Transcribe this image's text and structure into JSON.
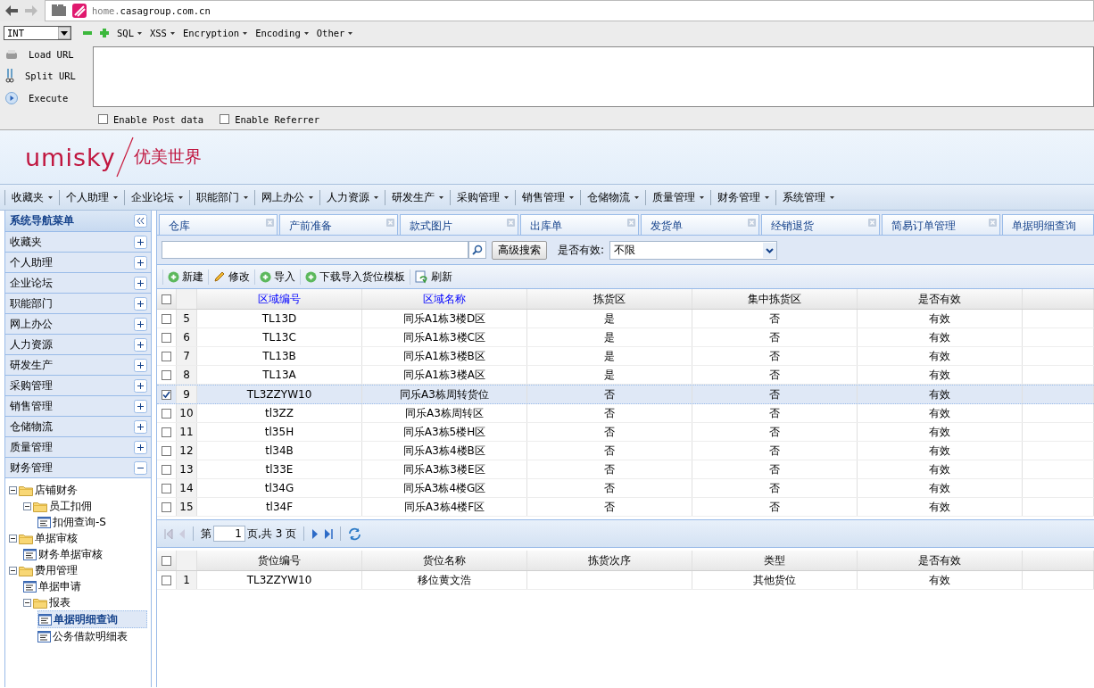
{
  "browser": {
    "url_host": "home.",
    "url_domain": "casagroup.com.cn"
  },
  "hackbar": {
    "type_select": "INT",
    "menus": [
      "SQL",
      "XSS",
      "Encryption",
      "Encoding",
      "Other"
    ],
    "actions": [
      {
        "label": "Load URL",
        "kind": "load"
      },
      {
        "label": "Split URL",
        "kind": "split"
      },
      {
        "label": "Execute",
        "kind": "execute"
      }
    ],
    "options": [
      {
        "label": "Enable Post data",
        "checked": false
      },
      {
        "label": "Enable Referrer",
        "checked": false
      }
    ]
  },
  "header": {
    "logo_latin": "umisky",
    "logo_cn": "优美世界"
  },
  "menu": [
    "收藏夹",
    "个人助理",
    "企业论坛",
    "职能部门",
    "网上办公",
    "人力资源",
    "研发生产",
    "采购管理",
    "销售管理",
    "仓储物流",
    "质量管理",
    "财务管理",
    "系统管理"
  ],
  "sidebar": {
    "title": "系统导航菜单",
    "items": [
      {
        "label": "收藏夹",
        "expanded": false
      },
      {
        "label": "个人助理",
        "expanded": false
      },
      {
        "label": "企业论坛",
        "expanded": false
      },
      {
        "label": "职能部门",
        "expanded": false
      },
      {
        "label": "网上办公",
        "expanded": false
      },
      {
        "label": "人力资源",
        "expanded": false
      },
      {
        "label": "研发生产",
        "expanded": false
      },
      {
        "label": "采购管理",
        "expanded": false
      },
      {
        "label": "销售管理",
        "expanded": false
      },
      {
        "label": "仓储物流",
        "expanded": false
      },
      {
        "label": "质量管理",
        "expanded": false
      },
      {
        "label": "财务管理",
        "expanded": true
      }
    ],
    "tree": [
      {
        "label": "店铺财务",
        "kind": "folder",
        "selected": false,
        "children": [
          {
            "label": "员工扣佣",
            "kind": "folder",
            "selected": false,
            "children": [
              {
                "label": "扣佣查询-S",
                "kind": "page",
                "selected": false
              }
            ]
          }
        ]
      },
      {
        "label": "单据审核",
        "kind": "folder",
        "selected": false,
        "children": [
          {
            "label": "财务单据审核",
            "kind": "page",
            "selected": false
          }
        ]
      },
      {
        "label": "费用管理",
        "kind": "folder",
        "selected": false,
        "children": [
          {
            "label": "单据申请",
            "kind": "page",
            "selected": false
          },
          {
            "label": "报表",
            "kind": "folder",
            "selected": false,
            "children": [
              {
                "label": "单据明细查询",
                "kind": "page",
                "selected": true
              },
              {
                "label": "公务借款明细表",
                "kind": "page",
                "selected": false
              }
            ]
          }
        ]
      }
    ]
  },
  "tabs": [
    {
      "label": "仓库",
      "closable": true
    },
    {
      "label": "产前准备",
      "closable": true
    },
    {
      "label": "款式图片",
      "closable": true
    },
    {
      "label": "出库单",
      "closable": true
    },
    {
      "label": "发货单",
      "closable": true
    },
    {
      "label": "经销退货",
      "closable": true
    },
    {
      "label": "简易订单管理",
      "closable": true
    },
    {
      "label": "单据明细查询",
      "closable": false
    }
  ],
  "search": {
    "button": "高级搜索",
    "filter_label": "是否有效:",
    "filter_value": "不限"
  },
  "toolbar": [
    {
      "label": "新建",
      "kind": "add"
    },
    {
      "label": "修改",
      "kind": "edit"
    },
    {
      "label": "导入",
      "kind": "add"
    },
    {
      "label": "下载导入货位模板",
      "kind": "add"
    },
    {
      "label": "刷新",
      "kind": "refresh"
    }
  ],
  "grid": {
    "all_selected": false,
    "columns": [
      {
        "label": "区域编号",
        "link": true
      },
      {
        "label": "区域名称",
        "link": true
      },
      {
        "label": "拣货区",
        "link": false
      },
      {
        "label": "集中拣货区",
        "link": false
      },
      {
        "label": "是否有效",
        "link": false
      }
    ],
    "rows": [
      {
        "num": "5",
        "code": "TL13D",
        "name": "同乐A1栋3楼D区",
        "pick": "是",
        "central": "否",
        "valid": "有效",
        "selected": false
      },
      {
        "num": "6",
        "code": "TL13C",
        "name": "同乐A1栋3楼C区",
        "pick": "是",
        "central": "否",
        "valid": "有效",
        "selected": false
      },
      {
        "num": "7",
        "code": "TL13B",
        "name": "同乐A1栋3楼B区",
        "pick": "是",
        "central": "否",
        "valid": "有效",
        "selected": false
      },
      {
        "num": "8",
        "code": "TL13A",
        "name": "同乐A1栋3楼A区",
        "pick": "是",
        "central": "否",
        "valid": "有效",
        "selected": false
      },
      {
        "num": "9",
        "code": "TL3ZZYW10",
        "name": "同乐A3栋周转货位",
        "pick": "否",
        "central": "否",
        "valid": "有效",
        "selected": true
      },
      {
        "num": "10",
        "code": "tl3ZZ",
        "name": "同乐A3栋周转区",
        "pick": "否",
        "central": "否",
        "valid": "有效",
        "selected": false
      },
      {
        "num": "11",
        "code": "tl35H",
        "name": "同乐A3栋5楼H区",
        "pick": "否",
        "central": "否",
        "valid": "有效",
        "selected": false
      },
      {
        "num": "12",
        "code": "tl34B",
        "name": "同乐A3栋4楼B区",
        "pick": "否",
        "central": "否",
        "valid": "有效",
        "selected": false
      },
      {
        "num": "13",
        "code": "tl33E",
        "name": "同乐A3栋3楼E区",
        "pick": "否",
        "central": "否",
        "valid": "有效",
        "selected": false
      },
      {
        "num": "14",
        "code": "tl34G",
        "name": "同乐A3栋4楼G区",
        "pick": "否",
        "central": "否",
        "valid": "有效",
        "selected": false
      },
      {
        "num": "15",
        "code": "tl34F",
        "name": "同乐A3栋4楼F区",
        "pick": "否",
        "central": "否",
        "valid": "有效",
        "selected": false
      }
    ]
  },
  "pager": {
    "before": "第",
    "page": "1",
    "after": "页,共 3 页"
  },
  "detail": {
    "all_selected": false,
    "columns": [
      "货位编号",
      "货位名称",
      "拣货次序",
      "类型",
      "是否有效"
    ],
    "rows": [
      {
        "num": "1",
        "code": "TL3ZZYW10",
        "name": "移位黄文浩",
        "type": "其他货位",
        "valid": "有效",
        "selected": false
      }
    ]
  }
}
